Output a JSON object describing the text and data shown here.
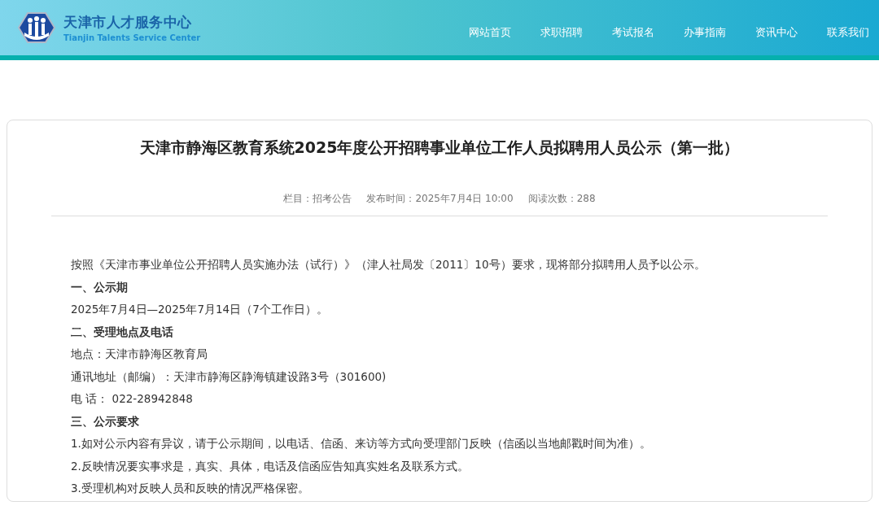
{
  "header": {
    "logo_title": "天津市人才服务中心",
    "logo_subtitle": "Tianjin Talents Service Center",
    "nav": [
      {
        "label": "网站首页"
      },
      {
        "label": "求职招聘"
      },
      {
        "label": "考试报名"
      },
      {
        "label": "办事指南"
      },
      {
        "label": "资讯中心"
      },
      {
        "label": "联系我们"
      }
    ]
  },
  "article": {
    "title": "天津市静海区教育系统2025年度公开招聘事业单位工作人员拟聘用人员公示（第一批）",
    "meta": [
      "栏目：招考公告",
      "发布时间：2025年7月4日 10:00",
      "阅读次数：288"
    ],
    "paragraphs": [
      {
        "kind": "text",
        "text": "按照《天津市事业单位公开招聘人员实施办法（试行）》（津人社局发〔2011〕10号）要求，现将部分拟聘用人员予以公示。"
      },
      {
        "kind": "heading",
        "text": "一、公示期"
      },
      {
        "kind": "text",
        "text": "2025年7月4日—2025年7月14日（7个工作日）。"
      },
      {
        "kind": "heading",
        "text": "二、受理地点及电话"
      },
      {
        "kind": "text",
        "text": "地点：天津市静海区教育局"
      },
      {
        "kind": "text",
        "text": "通讯地址（邮编）：天津市静海区静海镇建设路3号（301600)"
      },
      {
        "kind": "text",
        "text": "电 话： 022-28942848"
      },
      {
        "kind": "heading",
        "text": "三、公示要求"
      },
      {
        "kind": "text",
        "text": "1.如对公示内容有异议，请于公示期间，以电话、信函、来访等方式向受理部门反映（信函以当地邮戳时间为准）。"
      },
      {
        "kind": "text",
        "text": "2.反映情况要实事求是，真实、具体，电话及信函应告知真实姓名及联系方式。"
      },
      {
        "kind": "text",
        "text": "3.受理机构对反映人员和反映的情况严格保密。"
      }
    ]
  }
}
